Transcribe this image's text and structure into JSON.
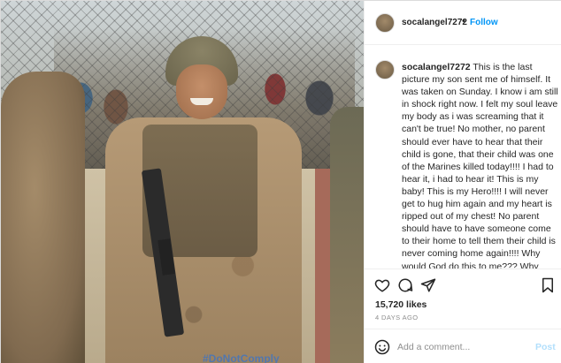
{
  "header": {
    "username": "socalangel7272",
    "separator": "•",
    "follow_label": "Follow"
  },
  "caption": {
    "username": "socalangel7272",
    "text": "This is the last picture my son sent me of himself. It was taken on Sunday. I know i am still in shock right now. I felt my soul leave my body as i was screaming that it can't be true! No mother, no parent should ever have to hear that their child is gone, that their child was one of the Marines killed today!!!! I had to hear it, i had to hear it! This is my baby! This is my Hero!!!! I will never get to hug him again and my heart is ripped out of my chest! No parent should have to have someone come to their home to tell them their child is never coming home again!!!! Why would God do this to me??? Why would he take my son???? This can't be real!! My heart hurts so bad. This is my baby Kareem. He was so amazing"
  },
  "actions": {
    "like_icon": "heart-icon",
    "comment_icon": "comment-icon",
    "share_icon": "share-icon",
    "save_icon": "bookmark-icon",
    "likes": "15,720 likes",
    "date": "4 DAYS AGO"
  },
  "comment_bar": {
    "emoji_icon": "emoji-icon",
    "placeholder": "Add a comment...",
    "post_label": "Post"
  },
  "photo": {
    "watermark": "#DoNotComply"
  },
  "colors": {
    "link_blue": "#0095f6",
    "post_disabled": "#b2dffc",
    "text_primary": "#262626",
    "text_muted": "#8e8e8e"
  }
}
